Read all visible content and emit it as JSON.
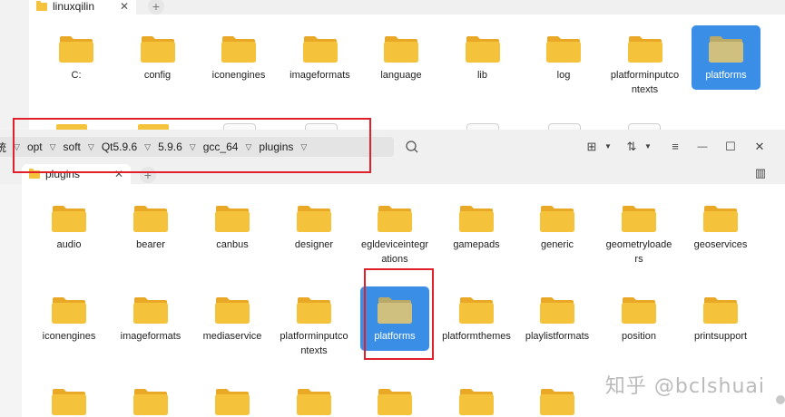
{
  "back_window": {
    "tab": {
      "label": "linuxqilin",
      "close": "✕"
    },
    "add_tab": "+",
    "folders": [
      {
        "name": "C:",
        "selected": false
      },
      {
        "name": "config",
        "selected": false
      },
      {
        "name": "iconengines",
        "selected": false
      },
      {
        "name": "imageformats",
        "selected": false
      },
      {
        "name": "language",
        "selected": false
      },
      {
        "name": "lib",
        "selected": false
      },
      {
        "name": "log",
        "selected": false
      },
      {
        "name": "platforminputcontexts",
        "selected": false
      },
      {
        "name": "platforms",
        "selected": true
      }
    ]
  },
  "front_window": {
    "breadcrumb": {
      "partial_first": "统",
      "items": [
        "opt",
        "soft",
        "Qt5.9.6",
        "5.9.6",
        "gcc_64",
        "plugins"
      ]
    },
    "toolbar": {
      "grid_view": "⊞",
      "sort": "⇅",
      "menu": "≡",
      "minimize": "—",
      "maximize": "☐",
      "close": "✕",
      "preview": "▥"
    },
    "tab": {
      "label": "plugins",
      "close": "✕"
    },
    "add_tab": "+",
    "folders_row1": [
      {
        "name": "audio"
      },
      {
        "name": "bearer"
      },
      {
        "name": "canbus"
      },
      {
        "name": "designer"
      },
      {
        "name": "egldeviceintegrations"
      },
      {
        "name": "gamepads"
      },
      {
        "name": "generic"
      },
      {
        "name": "geometryloaders"
      },
      {
        "name": "geoservices"
      }
    ],
    "folders_row2": [
      {
        "name": "iconengines",
        "selected": false
      },
      {
        "name": "imageformats",
        "selected": false
      },
      {
        "name": "mediaservice",
        "selected": false
      },
      {
        "name": "platforminputcontexts",
        "selected": false
      },
      {
        "name": "platforms",
        "selected": true
      },
      {
        "name": "platformthemes",
        "selected": false
      },
      {
        "name": "playlistformats",
        "selected": false
      },
      {
        "name": "position",
        "selected": false
      },
      {
        "name": "printsupport",
        "selected": false
      }
    ]
  },
  "watermark": "知乎 @bclshuai",
  "colors": {
    "folder": "#f5c33b",
    "folder_back": "#e9a825",
    "selected_bg": "#3a8ee6",
    "highlight_box": "#e0202a"
  }
}
